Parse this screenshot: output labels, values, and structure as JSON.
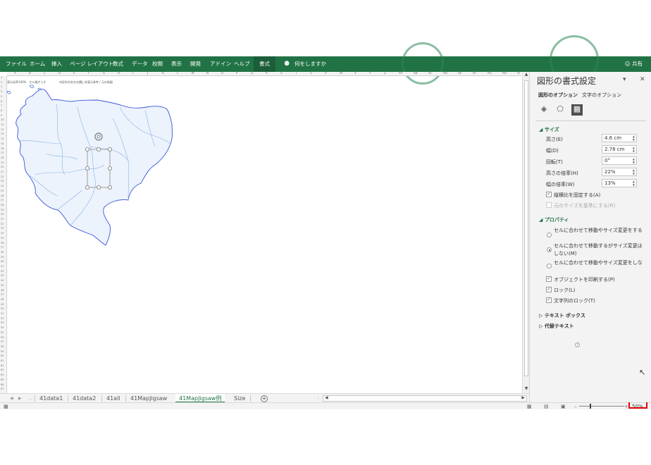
{
  "ribbon": {
    "tabs": [
      {
        "label": "ファイル"
      },
      {
        "label": "ホーム"
      },
      {
        "label": "挿入"
      },
      {
        "label": "ページ レイアウト"
      },
      {
        "label": "数式"
      },
      {
        "label": "データ"
      },
      {
        "label": "校閲"
      },
      {
        "label": "表示"
      },
      {
        "label": "開発"
      },
      {
        "label": "アドイン"
      },
      {
        "label": "ヘルプ"
      },
      {
        "label": "書式"
      }
    ],
    "tell_me": "何をしますか",
    "share": "共有"
  },
  "sheet": {
    "columns": [
      "A",
      "B",
      "C",
      "D",
      "E",
      "F",
      "G",
      "H",
      "I",
      "J",
      "K",
      "L",
      "M",
      "N",
      "O",
      "P",
      "Q",
      "R",
      "S",
      "T",
      "U",
      "V",
      "W",
      "X",
      "Y",
      "Z",
      "AA",
      "AB",
      "AC",
      "AD",
      "AE",
      "AF",
      "AG",
      "AH",
      "AI"
    ],
    "notes": [
      "表示倍率100%　セル幅ずらす",
      "市区町村名を右欄に非表示",
      "参考 / 元の地図"
    ]
  },
  "sheet_tabs": {
    "tabs": [
      "41data1",
      "41data2",
      "41all",
      "41MapJigsaw",
      "41MapJigsaw例",
      "Size"
    ],
    "active_index": 4
  },
  "status": {
    "zoom": "50%"
  },
  "pane": {
    "title": "図形の書式設定",
    "subtabs": [
      "図形のオプション",
      "文字のオプション"
    ],
    "size_section": "サイズ",
    "fields": [
      {
        "label": "高さ(E)",
        "value": "4.6 cm"
      },
      {
        "label": "幅(D)",
        "value": "2.78 cm"
      },
      {
        "label": "回転(T)",
        "value": "0°"
      },
      {
        "label": "高さの倍率(H)",
        "value": "22%"
      },
      {
        "label": "幅の倍率(W)",
        "value": "13%"
      }
    ],
    "lock_aspect": "縦横比を固定する(A)",
    "relative_original": "元のサイズを基準にする(R)",
    "properties_section": "プロパティ",
    "radios": [
      {
        "label": "セルに合わせて移動やサイズ変更をする(S)"
      },
      {
        "label": "セルに合わせて移動するがサイズ変更はしない(M)"
      },
      {
        "label": "セルに合わせて移動やサイズ変更をしない(D)"
      }
    ],
    "print_object": "オブジェクトを印刷する(P)",
    "lock": "ロック(L)",
    "lock_text": "文字列のロック(T)",
    "textbox_section": "テキスト ボックス",
    "alttext_section": "代替テキスト"
  }
}
